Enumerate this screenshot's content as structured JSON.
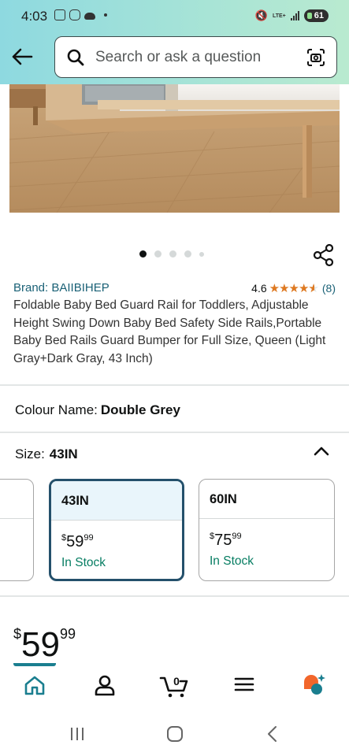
{
  "status_bar": {
    "time": "4:03",
    "network": "LTE+",
    "battery": "61"
  },
  "header": {
    "search_placeholder": "Search or ask a question"
  },
  "product": {
    "image_count": 5,
    "active_image_index": 0,
    "brand": "Brand: BAIIBIHEP",
    "rating": "4.6",
    "rating_value": 4.6,
    "reviews": "(8)",
    "title": "Foldable Baby Bed Guard Rail for Toddlers, Adjustable Height Swing Down Baby Bed Safety Side Rails,Portable Baby Bed Rails Guard Bumper for Full Size, Queen (Light Gray+Dark Gray, 43 Inch)"
  },
  "colour": {
    "label": "Colour Name:",
    "value": "Double Grey"
  },
  "size": {
    "label": "Size:",
    "value": "43IN",
    "options": [
      {
        "name": "",
        "currency": "",
        "price_whole": "",
        "price_cents": "",
        "stock": ""
      },
      {
        "name": "43IN",
        "currency": "$",
        "price_whole": "59",
        "price_cents": "99",
        "stock": "In Stock",
        "selected": true
      },
      {
        "name": "60IN",
        "currency": "$",
        "price_whole": "75",
        "price_cents": "99",
        "stock": "In Stock"
      }
    ]
  },
  "price": {
    "currency": "$",
    "whole": "59",
    "cents": "99"
  },
  "bottom_nav": {
    "cart_count": "0",
    "items": [
      "home-icon",
      "account-icon",
      "cart-icon",
      "menu-icon",
      "rufus-icon"
    ]
  },
  "colors": {
    "accent": "#1a7e8f",
    "link": "#1a6176",
    "star": "#de7921",
    "stock": "#067d62",
    "rufus": "#f2662b"
  }
}
